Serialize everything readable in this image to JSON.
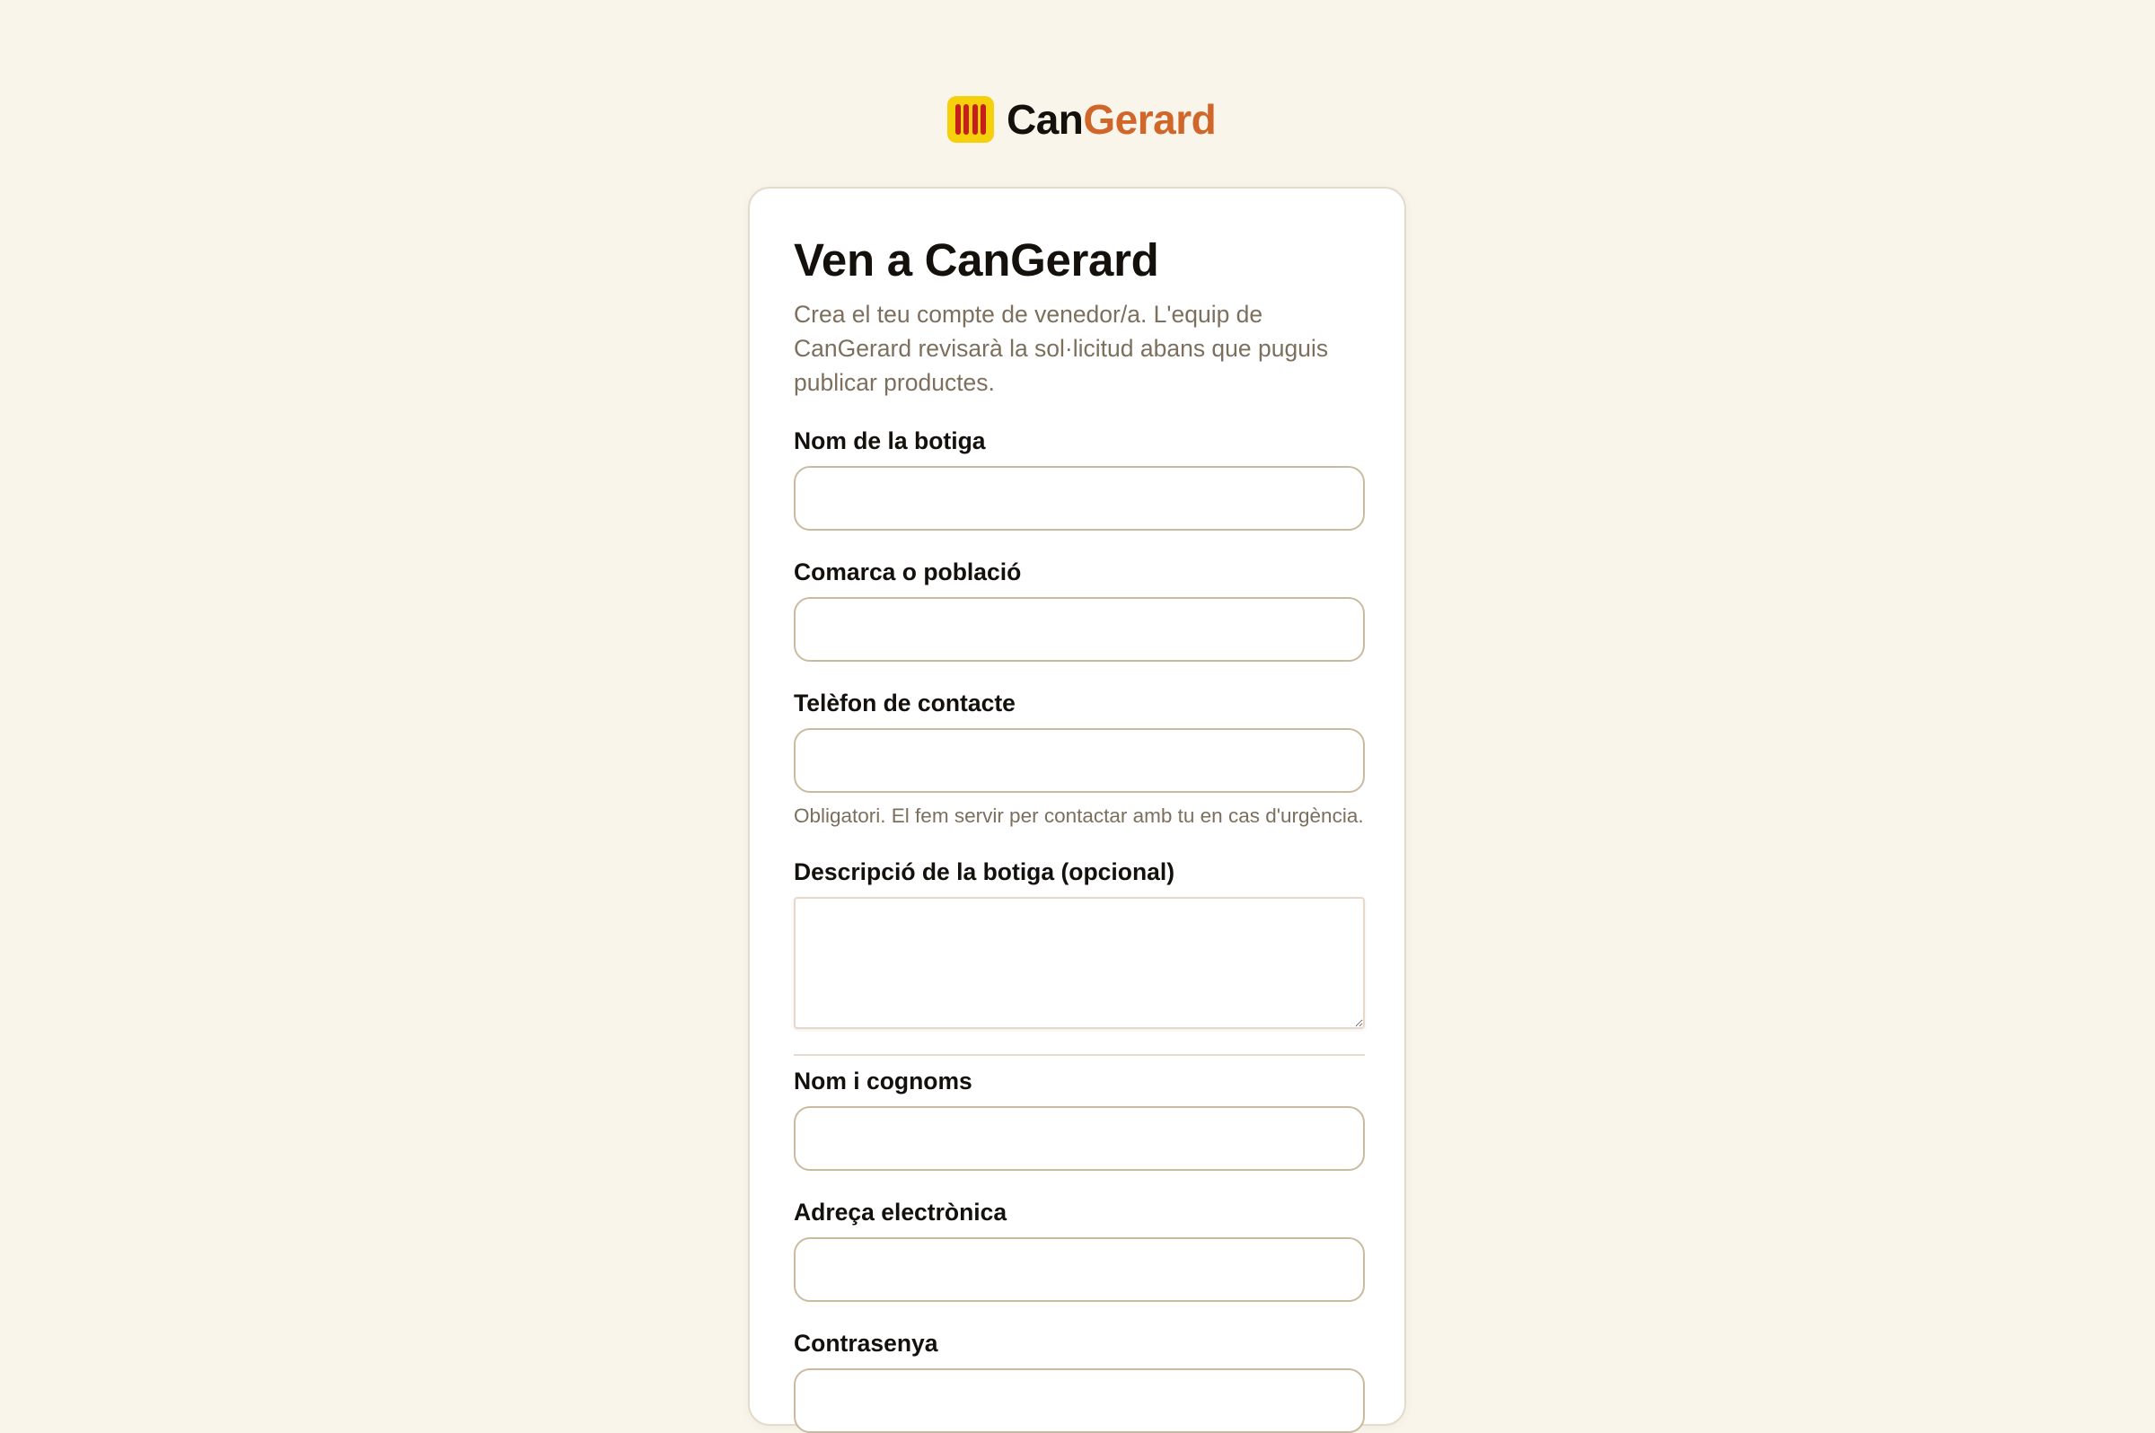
{
  "brand": {
    "logo_icon": "catalan-flag-icon",
    "colors": {
      "logo_bg": "#f6d00a",
      "logo_stripes": "#c61d1d",
      "accent": "#d0662a"
    },
    "name_part1": "Can",
    "name_part2": "Gerard"
  },
  "form": {
    "title": "Ven a CanGerard",
    "subtitle": "Crea el teu compte de venedor/a. L'equip de CanGerard revisarà la sol·licitud abans que puguis publicar productes.",
    "fields": {
      "shop_name": {
        "label": "Nom de la botiga",
        "value": ""
      },
      "region": {
        "label": "Comarca o població",
        "value": ""
      },
      "phone": {
        "label": "Telèfon de contacte",
        "value": "",
        "hint": "Obligatori. El fem servir per contactar amb tu en cas d'urgència."
      },
      "description": {
        "label": "Descripció de la botiga (opcional)",
        "value": ""
      },
      "full_name": {
        "label": "Nom i cognoms",
        "value": ""
      },
      "email": {
        "label": "Adreça electrònica",
        "value": ""
      },
      "password": {
        "label": "Contrasenya",
        "value": ""
      }
    }
  }
}
